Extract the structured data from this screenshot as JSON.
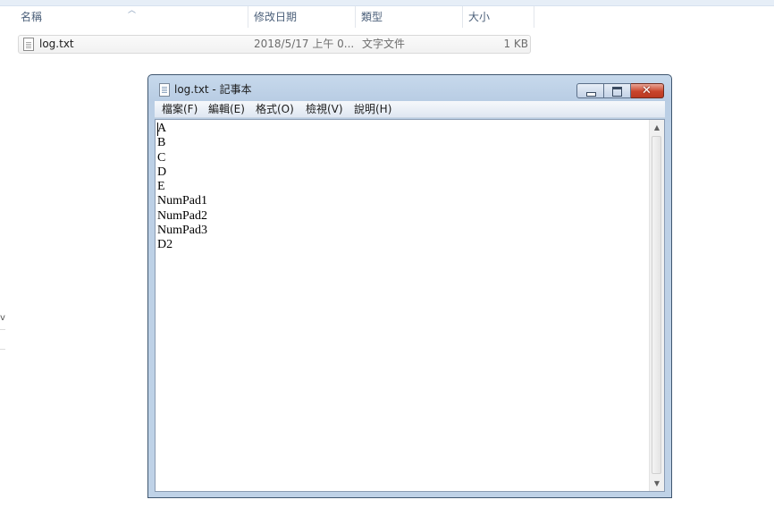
{
  "explorer": {
    "columns": {
      "name": "名稱",
      "modified": "修改日期",
      "type": "類型",
      "size": "大小"
    },
    "file": {
      "name": "log.txt",
      "modified": "2018/5/17 上午 0...",
      "type": "文字文件",
      "size": "1 KB"
    },
    "left_mark": "v"
  },
  "notepad": {
    "title": "log.txt - 記事本",
    "menu": [
      "檔案(F)",
      "編輯(E)",
      "格式(O)",
      "檢視(V)",
      "說明(H)"
    ],
    "close_label": "✕",
    "lines": [
      "A",
      "B",
      "C",
      "D",
      "E",
      "NumPad1",
      "NumPad2",
      "NumPad3",
      "D2"
    ],
    "scroll_up": "▲",
    "scroll_down": "▼"
  }
}
